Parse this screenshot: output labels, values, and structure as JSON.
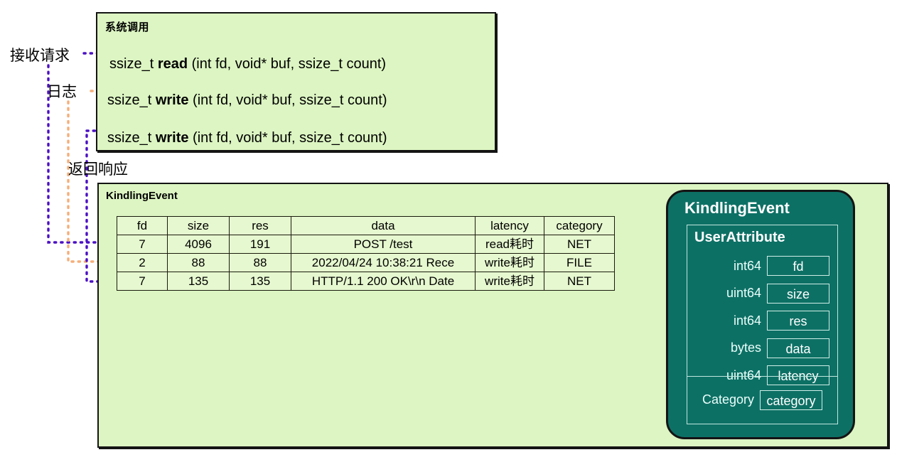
{
  "diagram": {
    "colors": {
      "light_green_fill": "#dcf5c2",
      "table_fill": "#e6f8cf",
      "dark_green_fill": "#0d7065",
      "border_black": "#141414",
      "arrow_purple": "#4b10c4",
      "arrow_orange": "#f5ae79"
    },
    "labels": [
      {
        "id": "recv",
        "text": "接收请求"
      },
      {
        "id": "log",
        "text": "日志"
      },
      {
        "id": "resp",
        "text": "返回响应"
      }
    ],
    "syscall_box": {
      "title": "系统调用",
      "lines": [
        {
          "ret": "ssize_t ",
          "name": "read",
          "args": " (int fd, void* buf, ssize_t count)"
        },
        {
          "ret": "ssize_t ",
          "name": "write",
          "args": " (int fd, void* buf, ssize_t count)"
        },
        {
          "ret": "ssize_t ",
          "name": "write",
          "args": " (int fd, void* buf, ssize_t count)"
        }
      ]
    },
    "kindling_box": {
      "title": "KindlingEvent",
      "table": {
        "columns": [
          "fd",
          "size",
          "res",
          "data",
          "latency",
          "category"
        ],
        "rows": [
          [
            "7",
            "4096",
            "191",
            "POST /test",
            "read耗时",
            "NET"
          ],
          [
            "2",
            "88",
            "88",
            "2022/04/24 10:38:21 Rece",
            "write耗时",
            "FILE"
          ],
          [
            "7",
            "135",
            "135",
            "HTTP/1.1 200 OK\\r\\n Date",
            "write耗时",
            "NET"
          ]
        ]
      }
    },
    "ke_panel": {
      "title": "KindlingEvent",
      "user_attribute": {
        "title": "UserAttribute",
        "fields": [
          {
            "type": "int64",
            "name": "fd"
          },
          {
            "type": "uint64",
            "name": "size"
          },
          {
            "type": "int64",
            "name": "res"
          },
          {
            "type": "bytes",
            "name": "data"
          },
          {
            "type": "uint64",
            "name": "latency"
          }
        ],
        "category": {
          "type": "Category",
          "name": "category"
        }
      }
    }
  }
}
